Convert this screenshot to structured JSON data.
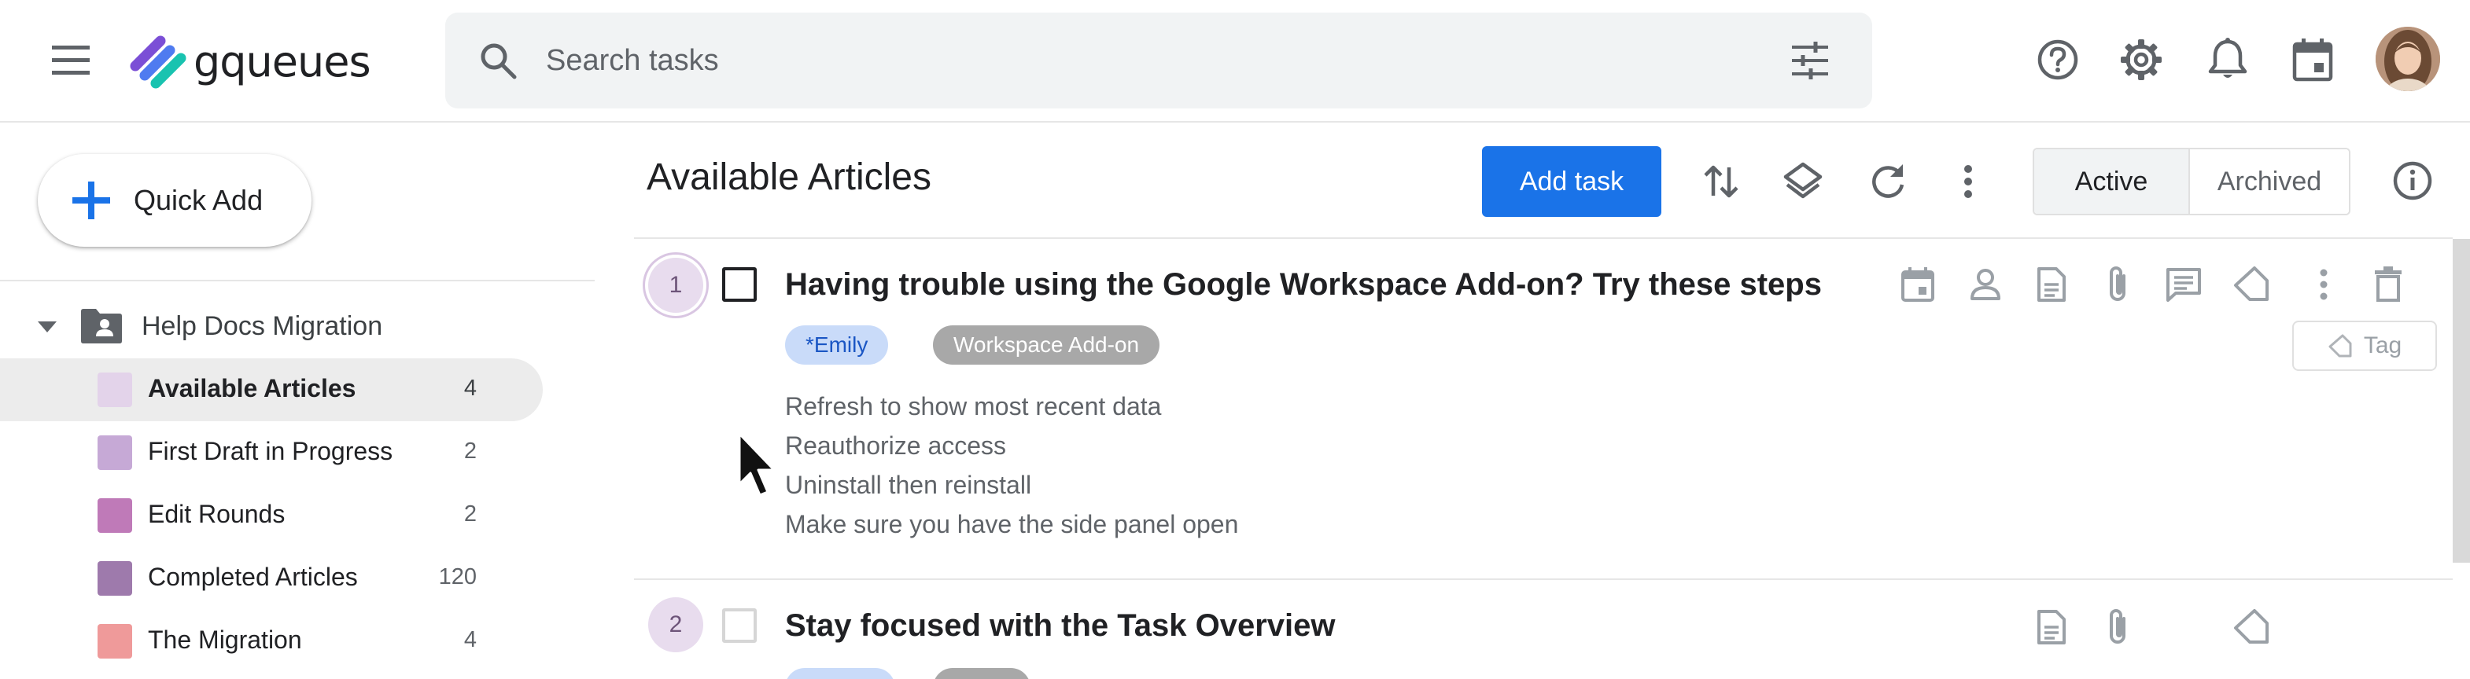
{
  "app": {
    "name": "gqueues",
    "colors": {
      "brand_purple": "#7b4fd6",
      "brand_teal": "#19c3b0",
      "accent_blue": "#1a73e8"
    }
  },
  "topbar": {
    "menu_icon": "hamburger-menu-icon",
    "search": {
      "placeholder": "Search tasks",
      "value": "",
      "icon": "search-icon",
      "filter_icon": "tune-icon"
    },
    "icons": [
      "help-icon",
      "settings-icon",
      "notifications-icon",
      "calendar-icon"
    ],
    "avatar": "user-avatar"
  },
  "sidebar": {
    "quick_add_label": "Quick Add",
    "folder": {
      "name": "Help Docs Migration",
      "expanded": true
    },
    "queues": [
      {
        "name": "Available Articles",
        "count": "4",
        "color": "#e3d3ea",
        "active": true
      },
      {
        "name": "First Draft in Progress",
        "count": "2",
        "color": "#c6a9d6",
        "active": false
      },
      {
        "name": "Edit Rounds",
        "count": "2",
        "color": "#bf7ab8",
        "active": false
      },
      {
        "name": "Completed Articles",
        "count": "120",
        "color": "#9e7aac",
        "active": false
      },
      {
        "name": "The Migration",
        "count": "4",
        "color": "#ef9a9a",
        "active": false
      }
    ]
  },
  "main": {
    "title": "Available Articles",
    "add_task_label": "Add task",
    "header_icons": [
      "sort-icon",
      "layers-icon",
      "refresh-icon",
      "more-vert-icon"
    ],
    "view_toggle": {
      "active": "Active",
      "archived": "Archived"
    },
    "info_icon": "info-icon"
  },
  "tasks": [
    {
      "number": "1",
      "title": "Having trouble using the Google Workspace Add-on? Try these steps",
      "checked": false,
      "tags": [
        "*Emily",
        "Workspace Add-on"
      ],
      "notes": [
        "Refresh to show most recent data",
        "Reauthorize access",
        "Uninstall then reinstall",
        "Make sure you have the side panel open"
      ],
      "add_tag_label": "Tag"
    },
    {
      "number": "2",
      "title": "Stay focused with the Task Overview",
      "checked": false
    }
  ]
}
